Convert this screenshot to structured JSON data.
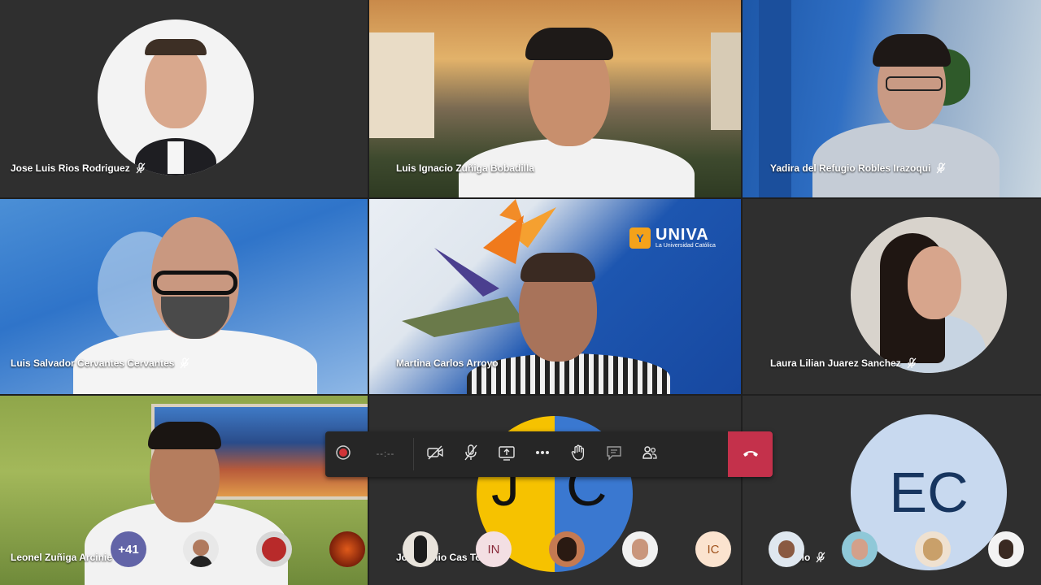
{
  "participants": [
    {
      "name": "Jose Luis Rios Rodriguez",
      "muted": true
    },
    {
      "name": "Luis Ignacio Zuñiga Bobadilla",
      "muted": false
    },
    {
      "name": "Yadira del Refugio Robles Irazoqui",
      "muted": true
    },
    {
      "name": "Luis Salvador Cervantes Cervantes",
      "muted": true
    },
    {
      "name": "Martina Carlos Arroyo",
      "muted": false
    },
    {
      "name": "Laura Lilian Juarez Sanchez",
      "muted": true
    },
    {
      "name": "Leonel Zuñiga Arcinie",
      "muted": false
    },
    {
      "name": "Jo Antonio Cas Torres",
      "muted": false
    },
    {
      "name": "Castelo",
      "muted": true
    }
  ],
  "initials": {
    "jc_left": "J",
    "jc_right": "C",
    "ec": "EC",
    "in": "IN",
    "ic": "IC"
  },
  "overflow_count": "+41",
  "logo": {
    "brand": "UNIVA",
    "tagline": "La Universidad Católica"
  },
  "toolbar": {
    "timer": "--:--",
    "icons": [
      "record-icon",
      "camera-off-icon",
      "mic-off-icon",
      "share-screen-icon",
      "more-options-icon",
      "raise-hand-icon",
      "chat-icon",
      "participants-icon",
      "hang-up-icon"
    ]
  },
  "colors": {
    "hangup": "#c4314b",
    "jc_yellow": "#f6c200",
    "jc_blue": "#3a78d0",
    "ec_bg": "#c8d9ef",
    "ec_text": "#17355f"
  }
}
